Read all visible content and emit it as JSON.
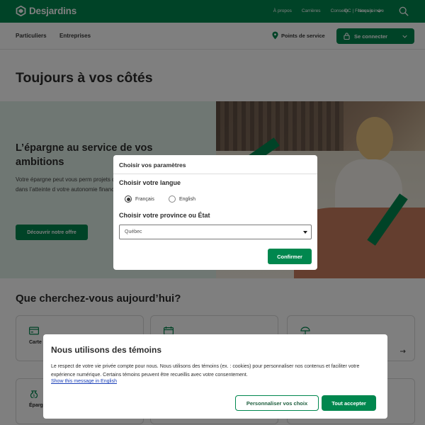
{
  "brand": {
    "name": "Desjardins",
    "color": "#00874e"
  },
  "topbar": {
    "links": [
      "À propos",
      "Carrières",
      "Conseils",
      "Nous joindre"
    ],
    "language_selector": "QC | Français"
  },
  "navbar": {
    "links": [
      "Particuliers",
      "Entreprises"
    ],
    "points_of_service": "Points de service",
    "login_label": "Se connecter"
  },
  "page_title": "Toujours à vos côtés",
  "hero": {
    "title": "L’épargne au service de vos ambitions",
    "text": "Votre épargne peut vous perm projets qui vous tiennent à co accompagner dans l’atteinte d votre autonomie financière.",
    "button": "Découvrir notre offre"
  },
  "search_section": {
    "title": "Que cherchez-vous aujourd’hui?",
    "cards": [
      {
        "label": "Carte",
        "icon": "credit-card-icon"
      },
      {
        "label": "",
        "icon": "calendar-icon"
      },
      {
        "label": "",
        "icon": "umbrella-icon"
      },
      {
        "label": "Éparg",
        "icon": "savings-icon"
      },
      {
        "label": "",
        "icon": ""
      },
      {
        "label": "",
        "icon": ""
      }
    ]
  },
  "settings_modal": {
    "title": "Choisir vos paramètres",
    "language_heading": "Choisir votre langue",
    "language_options": [
      "Français",
      "English"
    ],
    "selected_language": "Français",
    "province_heading": "Choisir votre province ou État",
    "province_value": "Québec",
    "confirm": "Confirmer"
  },
  "cookie_banner": {
    "title": "Nous utilisons des témoins",
    "text": "Le respect de votre vie privée compte pour nous. Nous utilisons des témoins (ex. : cookies) pour personnaliser nos contenus et faciliter votre expérience numérique. Certains témoins peuvent être recueillis avec votre consentement.",
    "link": "Show this message in English",
    "customize": "Personnaliser vos choix",
    "accept": "Tout accepter"
  }
}
